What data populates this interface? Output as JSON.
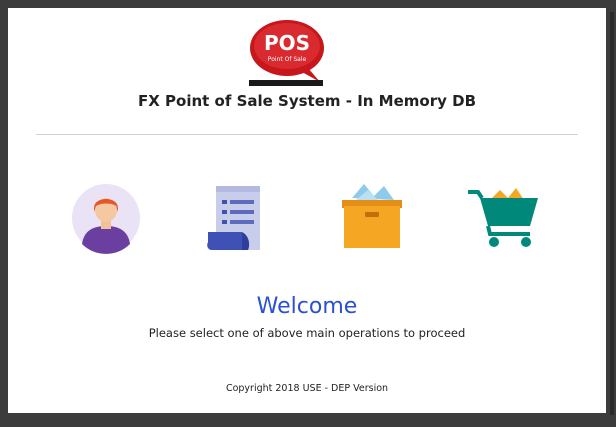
{
  "logo": {
    "text": "POS",
    "subtext": "Point Of Sale",
    "icon": "pos-speech-bubble-logo"
  },
  "header": {
    "title": "FX Point of Sale System - In Memory DB"
  },
  "operations": [
    {
      "icon": "user-avatar-icon"
    },
    {
      "icon": "document-list-icon"
    },
    {
      "icon": "inventory-box-icon"
    },
    {
      "icon": "shopping-cart-icon"
    }
  ],
  "main": {
    "welcome": "Welcome",
    "instruction": "Please select one of above main operations to proceed"
  },
  "footer": {
    "copyright": "Copyright 2018 USE - DEP Version"
  },
  "colors": {
    "accent": "#2b4fd6",
    "logo_red": "#c8161d",
    "avatar_purple": "#6b3fa0",
    "document_blue": "#3f51b5",
    "box_orange": "#f5a623",
    "cart_teal": "#00897b"
  }
}
